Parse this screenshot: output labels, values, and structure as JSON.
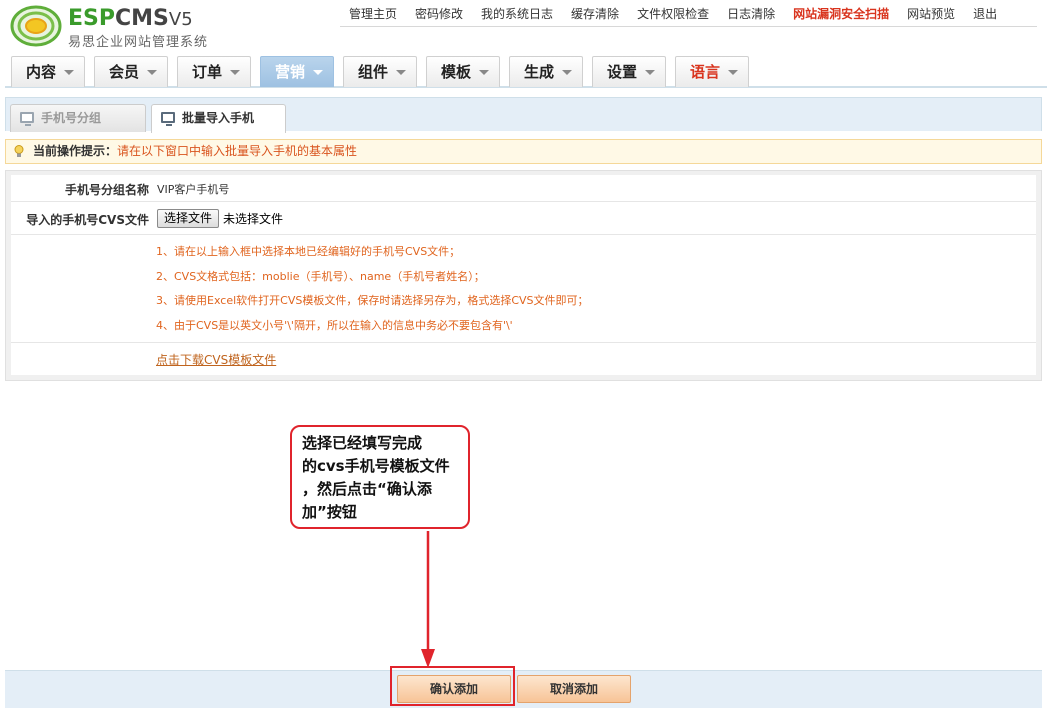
{
  "brand": {
    "name_part1": "ESP",
    "name_part2": "CMS",
    "version": "V5",
    "subtitle": "易思企业网站管理系统"
  },
  "top_links": [
    {
      "label": "管理主页"
    },
    {
      "label": "密码修改"
    },
    {
      "label": "我的系统日志"
    },
    {
      "label": "缓存清除"
    },
    {
      "label": "文件权限检查"
    },
    {
      "label": "日志清除"
    },
    {
      "label": "网站漏洞安全扫描"
    },
    {
      "label": "网站预览"
    },
    {
      "label": "退出"
    }
  ],
  "menu": [
    {
      "label": "内容"
    },
    {
      "label": "会员"
    },
    {
      "label": "订单"
    },
    {
      "label": "营销"
    },
    {
      "label": "组件"
    },
    {
      "label": "模板"
    },
    {
      "label": "生成"
    },
    {
      "label": "设置"
    },
    {
      "label": "语言"
    }
  ],
  "tabs": [
    {
      "label": "手机号分组"
    },
    {
      "label": "批量导入手机"
    }
  ],
  "hint": {
    "label": "当前操作提示：",
    "text": "请在以下窗口中输入批量导入手机的基本属性"
  },
  "form": {
    "group_label": "手机号分组名称",
    "group_value": "VIP客户手机号",
    "file_label": "导入的手机号CVS文件",
    "file_button": "选择文件",
    "file_status": "未选择文件",
    "notes": [
      "1、请在以上输入框中选择本地已经编辑好的手机号CVS文件；",
      "2、CVS文格式包括：moblie（手机号）、name（手机号者姓名）；",
      "3、请使用Excel软件打开CVS模板文件，保存时请选择另存为，格式选择CVS文件即可；",
      "4、由于CVS是以英文小号'\\'隔开，所以在输入的信息中务必不要包含有'\\'"
    ],
    "download_link": "点击下载CVS模板文件"
  },
  "callout": {
    "lines": [
      "选择已经填写完成",
      "的cvs手机号模板文件",
      "，然后点击“确认添",
      "加”按钮"
    ]
  },
  "buttons": {
    "confirm": "确认添加",
    "cancel": "取消添加"
  },
  "colors": {
    "accent_red": "#e0242c",
    "menu_active": "#9ec1e2",
    "note_orange": "#e0641e"
  }
}
